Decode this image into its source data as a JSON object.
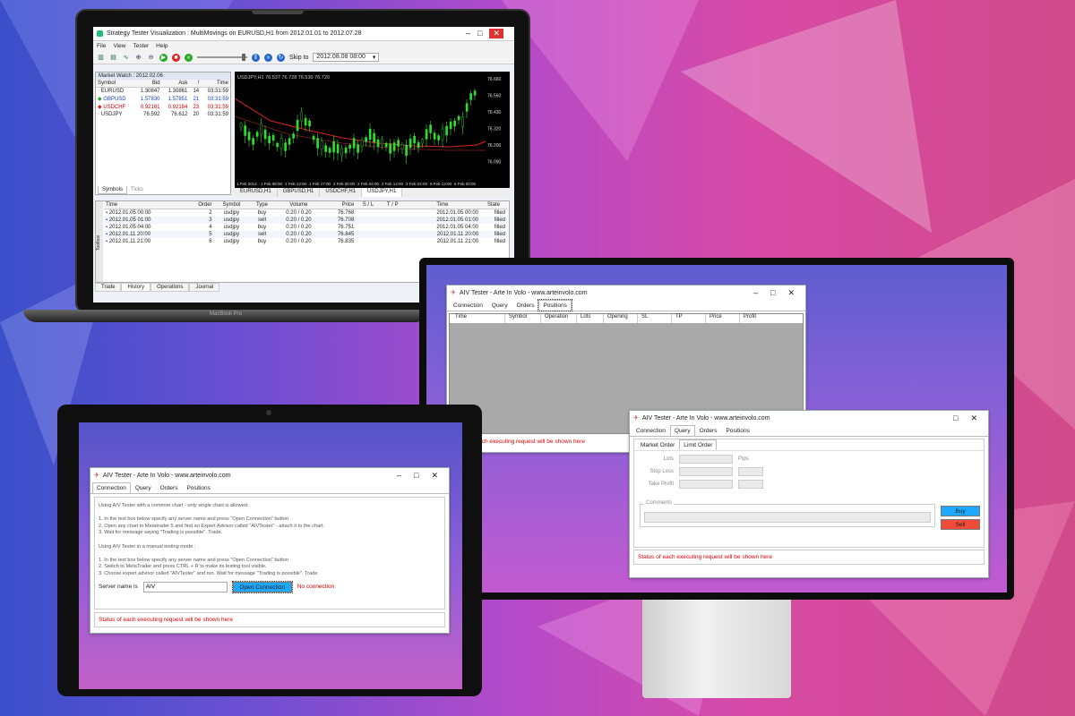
{
  "laptop": {
    "brand": "MacBook Pro",
    "app": {
      "title": "Strategy Tester Visualization : MultiMovings on EURUSD,H1 from 2012.01.01 to 2012.07.28",
      "menu": [
        "File",
        "View",
        "Tester",
        "Help"
      ],
      "skip_to_label": "Skip to",
      "skip_to_value": "2012.08.08 08:00",
      "market_watch_title": "Market Watch : 2012.02.06",
      "market_watch_columns": [
        "Symbol",
        "Bid",
        "Ask",
        "!",
        "Time"
      ],
      "market_watch_rows": [
        {
          "symbol": "EURUSD",
          "bid": "1.30847",
          "ask": "1.30861",
          "spread": "14",
          "time": "03:31:59"
        },
        {
          "symbol": "GBPUSD",
          "bid": "1.57830",
          "ask": "1.57851",
          "spread": "21",
          "time": "03:31:59"
        },
        {
          "symbol": "USDCHF",
          "bid": "0.92161",
          "ask": "0.92184",
          "spread": "23",
          "time": "03:31:59"
        },
        {
          "symbol": "USDJPY",
          "bid": "76.592",
          "ask": "76.612",
          "spread": "20",
          "time": "03:31:59"
        }
      ],
      "market_watch_tabs": [
        "Symbols",
        "Ticks"
      ],
      "chart_header": "USDJPY,H1  76.537 76.728 76.530 76.720",
      "price_labels": [
        "76.660",
        "76.560",
        "76.430",
        "76.320",
        "76.200",
        "76.090"
      ],
      "time_labels": [
        "1 Feb 2012",
        "1 Feb 08:00",
        "1 Feb 13:00",
        "1 Feb 17:00",
        "2 Feb 00:00",
        "2 Feb 04:00",
        "2 Feb 13:00",
        "3 Feb 04:00",
        "5 Feb 13:00",
        "6 Feb 00:00"
      ],
      "chart_tabs": [
        "EURUSD,H1",
        "GBPUSD,H1",
        "USDCHF,H1",
        "USDJPY,H1"
      ],
      "terminal_columns": [
        "Time",
        "Order",
        "Symbol",
        "Type",
        "Volume",
        "Price",
        "S / L",
        "T / P",
        "Time",
        "State"
      ],
      "terminal_rows": [
        {
          "time": "2012.01.05 00:00",
          "order": "2",
          "symbol": "usdjpy",
          "type": "buy",
          "volume": "0.20 / 0.20",
          "price": "76.768",
          "time2": "2012.01.05 00:00",
          "state": "filled"
        },
        {
          "time": "2012.01.05 01:00",
          "order": "3",
          "symbol": "usdjpy",
          "type": "sell",
          "volume": "0.20 / 0.20",
          "price": "76.708",
          "time2": "2012.01.05 01:00",
          "state": "filled"
        },
        {
          "time": "2012.01.05 04:00",
          "order": "4",
          "symbol": "usdjpy",
          "type": "buy",
          "volume": "0.20 / 0.20",
          "price": "76.751",
          "time2": "2012.01.05 04:00",
          "state": "filled"
        },
        {
          "time": "2012.01.11 20:00",
          "order": "5",
          "symbol": "usdjpy",
          "type": "sell",
          "volume": "0.20 / 0.20",
          "price": "76.845",
          "time2": "2012.01.11 20:00",
          "state": "filled"
        },
        {
          "time": "2012.01.11 21:00",
          "order": "6",
          "symbol": "usdjpy",
          "type": "buy",
          "volume": "0.20 / 0.20",
          "price": "76.835",
          "time2": "2012.01.11 21:00",
          "state": "filled"
        }
      ],
      "terminal_tabs": [
        "Trade",
        "History",
        "Operations",
        "Journal"
      ],
      "toolbox_label": "Toolbox"
    }
  },
  "monitor": {
    "window_back": {
      "title": "AIV Tester - Arte In Volo - www.arteinvolo.com",
      "tabs": [
        "Connection",
        "Query",
        "Orders",
        "Positions"
      ],
      "columns": [
        "Time",
        "Symbol",
        "Operation",
        "Lots",
        "Opening",
        "SL",
        "TP",
        "Price",
        "Profit"
      ],
      "status": "Status of each executing request will be shown here"
    },
    "window_front": {
      "title": "AIV Tester - Arte In Volo - www.arteinvolo.com",
      "tabs": [
        "Connection",
        "Query",
        "Orders",
        "Positions"
      ],
      "subtabs": [
        "Market Order",
        "Limit Order"
      ],
      "lots_label": "Lots",
      "lots_unit": "Pips",
      "stop_loss_label": "Stop Loss",
      "take_profit_label": "Take Profit",
      "comments_label": "Comments",
      "buy_label": "Buy",
      "sell_label": "Sell",
      "status": "Status of each executing request will be shown here"
    }
  },
  "tablet": {
    "window": {
      "title": "AIV Tester - Arte In Volo - www.arteinvolo.com",
      "tabs": [
        "Connection",
        "Query",
        "Orders",
        "Positions"
      ],
      "lines": [
        "Using AIV Tester with a common chart - only single chart is allowed:",
        "",
        "1. In the text box below specify any server name and press \"Open Connection\" button",
        "2. Open any chart in Metatrader 5 and find an Expert Advisor called \"AIVTester\" - attach it to the chart.",
        "3. Wait for message saying \"Trading is possible\". Trade.",
        "",
        "Using AIV Tester in a manual testing mode :",
        "",
        "1. In the text box below specify any server name and press \"Open Connection\" button",
        "2. Switch to MetaTrader and press CTRL + R to make its testing tool visible,",
        "3. Choose expert advisor called \"AIVTester\" and run. Wait for message \"Trading is possible\". Trade."
      ],
      "server_label": "Server name is",
      "server_value": "AIV",
      "open_button": "Open Connection",
      "connection_status": "No connection",
      "status": "Status of each executing request will be shown here"
    }
  },
  "colors": {
    "accent_blue": "#1fa8ff",
    "sell_red": "#f04a3a",
    "status_red": "#dd0000",
    "candle_green": "#2ee02e"
  }
}
